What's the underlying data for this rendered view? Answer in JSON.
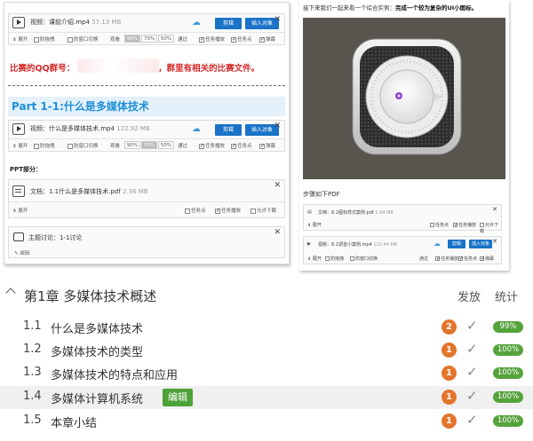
{
  "left": {
    "card1": {
      "filename": "视频：课前介绍.mp4",
      "size": "57.13 MB",
      "btn1": "剪辑",
      "btn2": "插入对象"
    },
    "opts": {
      "expand": "展开",
      "anti_drag": "防拖拽",
      "anti_switch": "防窗口切换",
      "watch": "观看",
      "p90": "90%",
      "p70": "70%",
      "p50": "50%",
      "pass": "通过",
      "task_play": "任务播放",
      "task_point": "任务点",
      "popup": "弹幕"
    },
    "qq_line": {
      "prefix": "比赛的QQ群号：",
      "suffix": "，群里有相关的比赛文件。"
    },
    "part_title": "Part 1-1:什么是多媒体技术",
    "card2": {
      "filename": "视频：什么是多媒体技术.mp4",
      "size": "122.92 MB",
      "btn1": "剪辑",
      "btn2": "插入对象"
    },
    "ppt_label": "PPT部分：",
    "doc_card": {
      "filename": "文档：1.1什么是多媒体技术.pdf",
      "size": "2.36 MB",
      "expand": "展开",
      "task_point": "任务点",
      "task_play": "任务播放",
      "allow_download": "允许下载"
    },
    "topic_card": {
      "title": "主题讨论：1-1讨论",
      "edit": "编辑"
    }
  },
  "right": {
    "intro_prefix": "接下来我们一起来看一个综合实例：",
    "intro_bold": "完成一个较为复杂的UI小图标。",
    "steps": "步骤如下PDF",
    "doc_card": {
      "filename": "文档：8.2图标样式案例.pdf",
      "size": "1.94 MB",
      "expand": "展开",
      "task_point": "任务点",
      "task_play": "任务播放",
      "allow_download": "允许下载"
    },
    "video_card": {
      "filename": "视频：8.2调音小案例.mp4",
      "size": "110.44 MB",
      "btn1": "剪辑",
      "btn2": "插入对象",
      "expand": "展开",
      "anti_drag": "防拖拽",
      "anti_switch": "防窗口切换",
      "pass": "通过",
      "task_play": "任务播放",
      "task_point": "任务点",
      "popup": "弹幕"
    }
  },
  "chapter": {
    "title": "第1章 多媒体技术概述",
    "col_publish": "发放",
    "col_stats": "统计",
    "sections": [
      {
        "num": "1.1",
        "title": "什么是多媒体技术",
        "badge": "2",
        "pct": "99%"
      },
      {
        "num": "1.2",
        "title": "多媒体技术的类型",
        "badge": "1",
        "pct": "100%"
      },
      {
        "num": "1.3",
        "title": "多媒体技术的特点和应用",
        "badge": "1",
        "pct": "100%"
      },
      {
        "num": "1.4",
        "title": "多媒体计算机系统",
        "badge": "1",
        "pct": "100%",
        "edit": "编辑"
      },
      {
        "num": "1.5",
        "title": "本章小结",
        "badge": "1",
        "pct": "100%"
      }
    ]
  },
  "colors": {
    "accent_blue": "#1a73c7",
    "badge_orange": "#e3742b",
    "pill_green": "#55a33c",
    "red_text": "#d42a2a"
  }
}
